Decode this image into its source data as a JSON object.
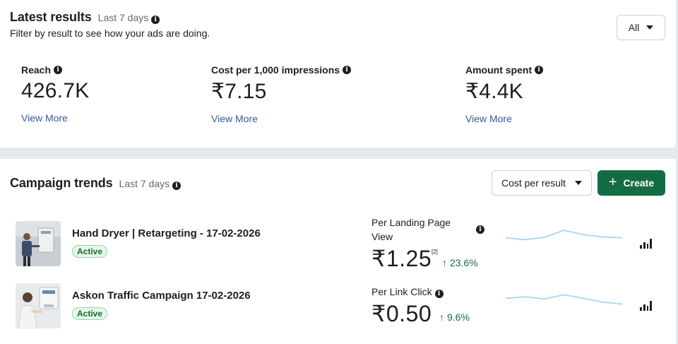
{
  "latest_results": {
    "title": "Latest results",
    "range": "Last 7 days",
    "subtitle": "Filter by result to see how your ads are doing.",
    "filter_label": "All",
    "metrics": [
      {
        "label": "Reach",
        "value": "426.7K",
        "link": "View More"
      },
      {
        "label": "Cost per 1,000 impressions",
        "value": "₹7.15",
        "link": "View More"
      },
      {
        "label": "Amount spent",
        "value": "₹4.4K",
        "link": "View More"
      }
    ]
  },
  "campaign_trends": {
    "title": "Campaign trends",
    "range": "Last 7 days",
    "metric_select": "Cost per result",
    "create_label": "Create",
    "campaigns": [
      {
        "name": "Hand Dryer | Retargeting - 17-02-2026",
        "status": "Active",
        "kpi_label_line1": "Per Landing Page",
        "kpi_label_line2": "View",
        "kpi_value": "₹1.25",
        "kpi_footnote": "[2]",
        "kpi_change": "23.6%",
        "trend": [
          0.52,
          0.4,
          0.55,
          1.0,
          0.72,
          0.57,
          0.52
        ]
      },
      {
        "name": "Askon Traffic Campaign 17-02-2026",
        "status": "Active",
        "kpi_label_line1": "Per Link Click",
        "kpi_value": "₹0.50",
        "kpi_change": "9.6%",
        "trend": [
          0.62,
          0.72,
          0.58,
          0.85,
          0.62,
          0.38,
          0.25
        ]
      }
    ]
  },
  "colors": {
    "primary_green": "#146c43",
    "link_blue": "#385898",
    "spark_line": "#a9dcef",
    "badge_bg": "#e7f6ec"
  },
  "icons": [
    "info-icon",
    "caret-down-icon",
    "plus-icon",
    "arrow-up-icon",
    "bar-chart-icon"
  ]
}
